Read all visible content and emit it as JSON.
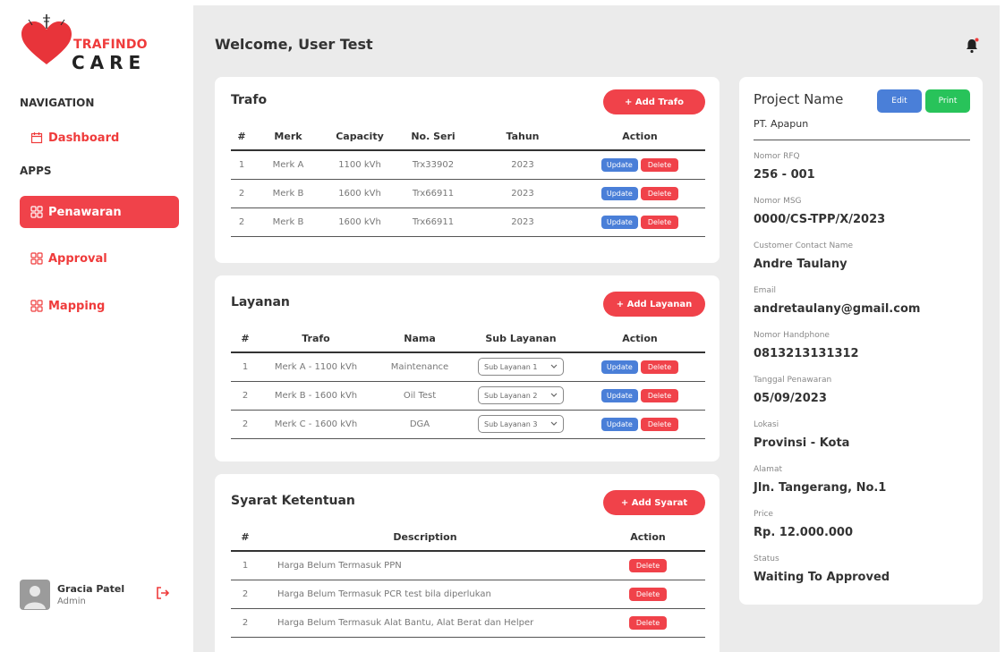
{
  "brand": {
    "line1": "TRAFINDO",
    "line2": "CARE",
    "accent": "#f0424a"
  },
  "nav": {
    "nav_heading": "NAVIGATION",
    "apps_heading": "APPS",
    "dashboard": "Dashboard",
    "items": [
      {
        "label": "Penawaran",
        "active": true
      },
      {
        "label": "Approval",
        "active": false
      },
      {
        "label": "Mapping",
        "active": false
      }
    ]
  },
  "user": {
    "name": "Gracia Patel",
    "role": "Admin"
  },
  "header": {
    "welcome": "Welcome, User Test"
  },
  "trafo": {
    "title": "Trafo",
    "add_label": "+ Add Trafo",
    "columns": [
      "#",
      "Merk",
      "Capacity",
      "No. Seri",
      "Tahun",
      "Action"
    ],
    "rows": [
      {
        "no": "1",
        "merk": "Merk A",
        "capacity": "1100 kVh",
        "seri": "Trx33902",
        "tahun": "2023"
      },
      {
        "no": "2",
        "merk": "Merk B",
        "capacity": "1600 kVh",
        "seri": "Trx66911",
        "tahun": "2023"
      },
      {
        "no": "2",
        "merk": "Merk B",
        "capacity": "1600 kVh",
        "seri": "Trx66911",
        "tahun": "2023"
      }
    ],
    "update_label": "Update",
    "delete_label": "Delete"
  },
  "layanan": {
    "title": "Layanan",
    "add_label": "+ Add Layanan",
    "columns": [
      "#",
      "Trafo",
      "Nama",
      "Sub Layanan",
      "Action"
    ],
    "rows": [
      {
        "no": "1",
        "trafo": "Merk A - 1100 kVh",
        "nama": "Maintenance",
        "sub": "Sub Layanan 1"
      },
      {
        "no": "2",
        "trafo": "Merk B - 1600 kVh",
        "nama": "Oil Test",
        "sub": "Sub Layanan 2"
      },
      {
        "no": "2",
        "trafo": "Merk C - 1600 kVh",
        "nama": "DGA",
        "sub": "Sub Layanan 3"
      }
    ],
    "update_label": "Update",
    "delete_label": "Delete"
  },
  "syarat": {
    "title": "Syarat Ketentuan",
    "add_label": "+ Add Syarat",
    "columns": [
      "#",
      "Description",
      "Action"
    ],
    "rows": [
      {
        "no": "1",
        "desc": "Harga Belum Termasuk PPN"
      },
      {
        "no": "2",
        "desc": "Harga Belum Termasuk PCR test bila diperlukan"
      },
      {
        "no": "2",
        "desc": "Harga Belum Termasuk Alat Bantu, Alat Berat dan Helper"
      }
    ],
    "delete_label": "Delete"
  },
  "project": {
    "title": "Project Name",
    "edit_label": "Edit",
    "print_label": "Print",
    "company": "PT. Apapun",
    "fields": [
      {
        "label": "Nomor RFQ",
        "value": "256 - 001"
      },
      {
        "label": "Nomor MSG",
        "value": "0000/CS-TPP/X/2023"
      },
      {
        "label": "Customer Contact Name",
        "value": "Andre Taulany"
      },
      {
        "label": "Email",
        "value": "andretaulany@gmail.com"
      },
      {
        "label": "Nomor Handphone",
        "value": "0813213131312"
      },
      {
        "label": "Tanggal Penawaran",
        "value": "05/09/2023"
      },
      {
        "label": "Lokasi",
        "value": "Provinsi - Kota"
      },
      {
        "label": "Alamat",
        "value": "Jln. Tangerang, No.1"
      },
      {
        "label": "Price",
        "value": "Rp. 12.000.000"
      },
      {
        "label": "Status",
        "value": "Waiting To Approved"
      }
    ]
  }
}
